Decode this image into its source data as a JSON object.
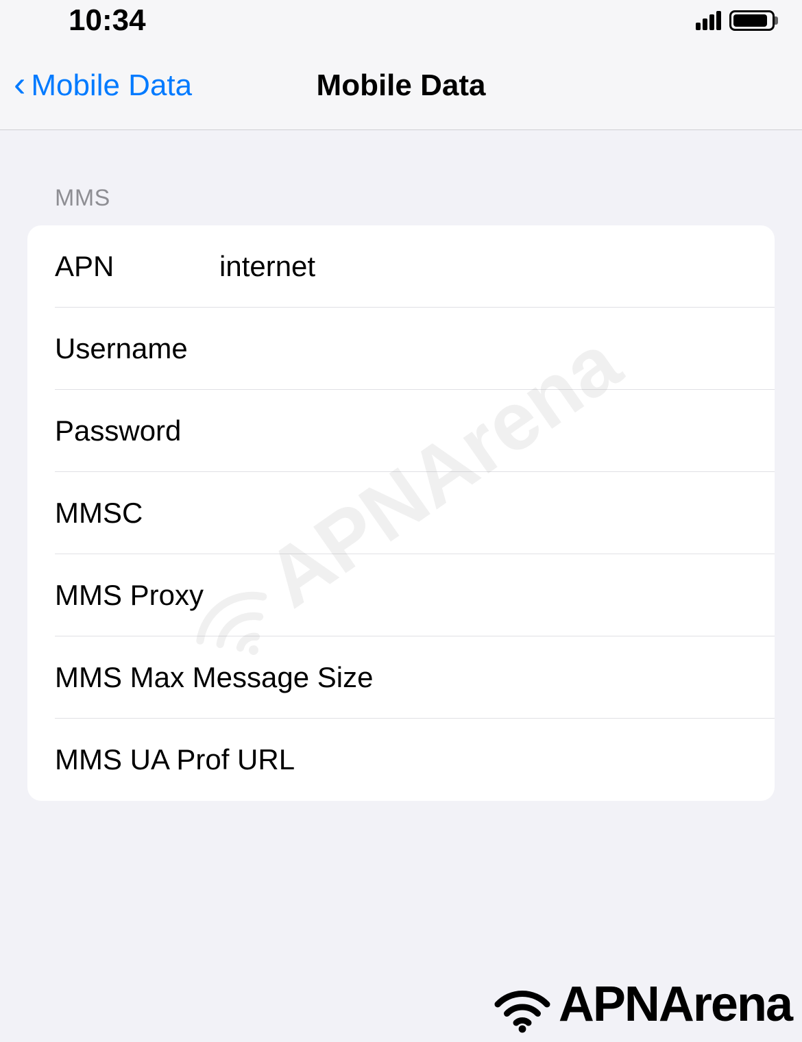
{
  "status_bar": {
    "time": "10:34"
  },
  "nav": {
    "back_label": "Mobile Data",
    "title": "Mobile Data"
  },
  "section_header": "MMS",
  "fields": {
    "apn": {
      "label": "APN",
      "value": "internet"
    },
    "username": {
      "label": "Username",
      "value": ""
    },
    "password": {
      "label": "Password",
      "value": ""
    },
    "mmsc": {
      "label": "MMSC",
      "value": ""
    },
    "mms_proxy": {
      "label": "MMS Proxy",
      "value": ""
    },
    "mms_max_size": {
      "label": "MMS Max Message Size",
      "value": ""
    },
    "mms_ua_prof": {
      "label": "MMS UA Prof URL",
      "value": ""
    }
  },
  "watermark": "APNArena"
}
